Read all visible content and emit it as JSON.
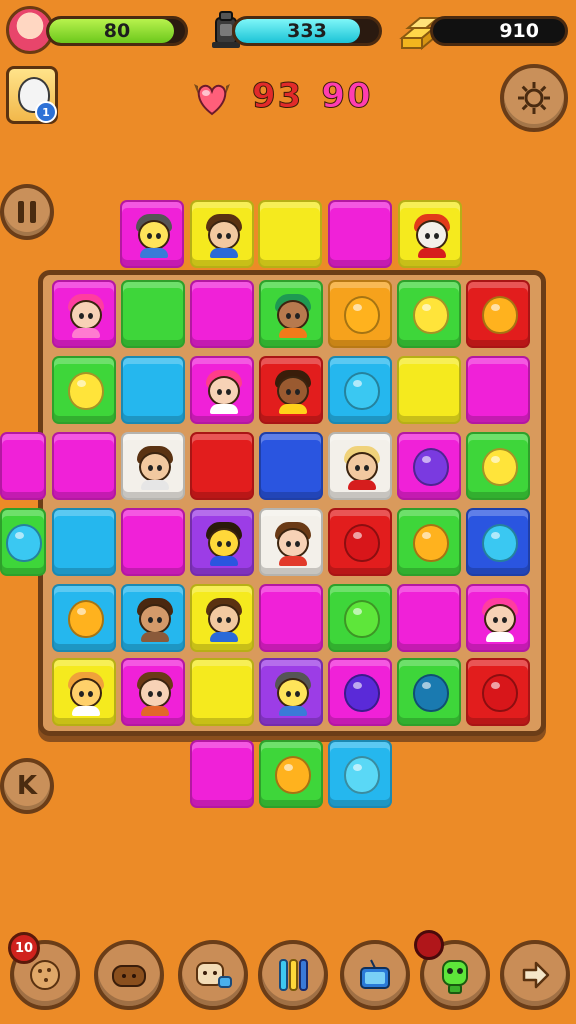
{
  "hud": {
    "health_value": "80",
    "health_level": 0.92,
    "energy_value": "333",
    "energy_level": 0.87,
    "gold_value": "910",
    "colors": {
      "health": "#8ee02a",
      "energy": "#29e6ee",
      "gold": "#1a1a1a"
    }
  },
  "player": {
    "level_badge": "1",
    "avatar_icon": "cat-avatar-icon"
  },
  "scores": {
    "left": "93",
    "right": "90"
  },
  "controls": {
    "pause_icon": "pause-icon",
    "settings_icon": "gear-icon",
    "back_label": "K"
  },
  "toolbar": {
    "badge_count": "10",
    "items": [
      "cookie-icon",
      "bread-icon",
      "toast-icon",
      "bars-icon",
      "tv-icon",
      "robot-icon",
      "arrow-right-icon"
    ]
  },
  "board": {
    "columns": 7,
    "rows": 6,
    "palette": [
      "green",
      "magenta",
      "yellow",
      "cyan",
      "red",
      "blue",
      "orange",
      "purple",
      "white"
    ]
  }
}
